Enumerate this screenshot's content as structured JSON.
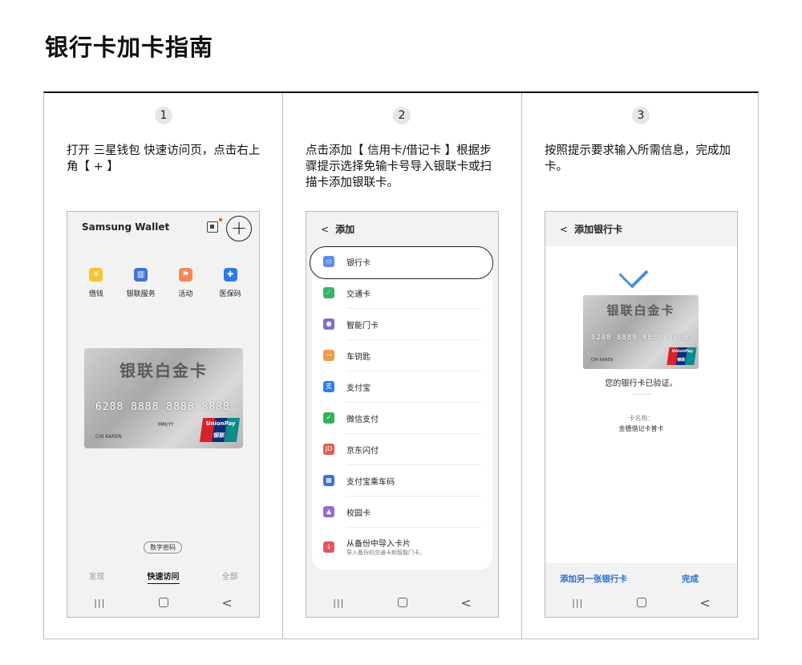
{
  "title": "银行卡加卡指南",
  "steps": [
    {
      "num": "1",
      "text": "打开 三星钱包 快速访问页，点击右上角【 + 】"
    },
    {
      "num": "2",
      "text": "点击添加【 信用卡/借记卡 】根据步骤提示选择免输卡号导入银联卡或扫描卡添加银联卡。"
    },
    {
      "num": "3",
      "text": "按照提示要求输入所需信息，完成加卡。"
    }
  ],
  "phone1": {
    "app_title": "Samsung Wallet",
    "add_symbol": "+",
    "quick_actions": [
      {
        "label": "借钱",
        "icon": "money-icon",
        "color": "#f5c431",
        "glyph": "¥"
      },
      {
        "label": "银联服务",
        "icon": "bank-icon",
        "color": "#3f73d6",
        "glyph": "▥"
      },
      {
        "label": "活动",
        "icon": "flag-icon",
        "color": "#f28a55",
        "glyph": "⚑"
      },
      {
        "label": "医保码",
        "icon": "medical-icon",
        "color": "#2f7ae5",
        "glyph": "✚"
      }
    ],
    "card": {
      "title": "银联白金卡",
      "number": "6288 8888 8888 8888",
      "expiry": "MM/YY",
      "holder": "CHI KAREN",
      "brand": "UnionPay",
      "brand_cn": "银联"
    },
    "pin_badge": "数字密码",
    "tabs": [
      "发现",
      "快速访问",
      "全部"
    ],
    "active_tab": "快速访问"
  },
  "phone2": {
    "back": "<",
    "title": "添加",
    "items": [
      {
        "label": "银行卡",
        "icon": "bank-card-icon",
        "color": "#5b8def",
        "glyph": "▭"
      },
      {
        "label": "交通卡",
        "icon": "transit-card-icon",
        "color": "#37b36b",
        "glyph": "⟋"
      },
      {
        "label": "智能门卡",
        "icon": "door-card-icon",
        "color": "#7d6fd1",
        "glyph": "●"
      },
      {
        "label": "车钥匙",
        "icon": "car-key-icon",
        "color": "#f39a4b",
        "glyph": "⊸"
      },
      {
        "label": "支付宝",
        "icon": "alipay-icon",
        "color": "#2e7cf6",
        "glyph": "支"
      },
      {
        "label": "微信支付",
        "icon": "wechat-pay-icon",
        "color": "#33b25a",
        "glyph": "✓"
      },
      {
        "label": "京东闪付",
        "icon": "jd-pay-icon",
        "color": "#e55b4f",
        "glyph": "JD"
      },
      {
        "label": "支付宝乘车码",
        "icon": "alipay-transit-icon",
        "color": "#3e6fe0",
        "glyph": "▦"
      },
      {
        "label": "校园卡",
        "icon": "campus-card-icon",
        "color": "#9a6ad6",
        "glyph": "▲"
      },
      {
        "label": "从备份中导入卡片",
        "sub": "导入备份的交通卡和智能门卡。",
        "icon": "import-icon",
        "color": "#e25563",
        "glyph": "↓"
      }
    ]
  },
  "phone3": {
    "back": "<",
    "title": "添加银行卡",
    "card": {
      "title": "银联白金卡",
      "number": "6288 8888 8888 8888",
      "holder": "CHI KAREN",
      "brand": "UnionPay",
      "brand_cn": "银联"
    },
    "verified_text": "您的银行卡已验证。",
    "card_name_label": "卡名称：",
    "card_name_value": "金穗借记卡普卡",
    "add_another": "添加另一张银行卡",
    "done": "完成"
  },
  "navbar": {
    "recent": "|||",
    "back": "<"
  }
}
